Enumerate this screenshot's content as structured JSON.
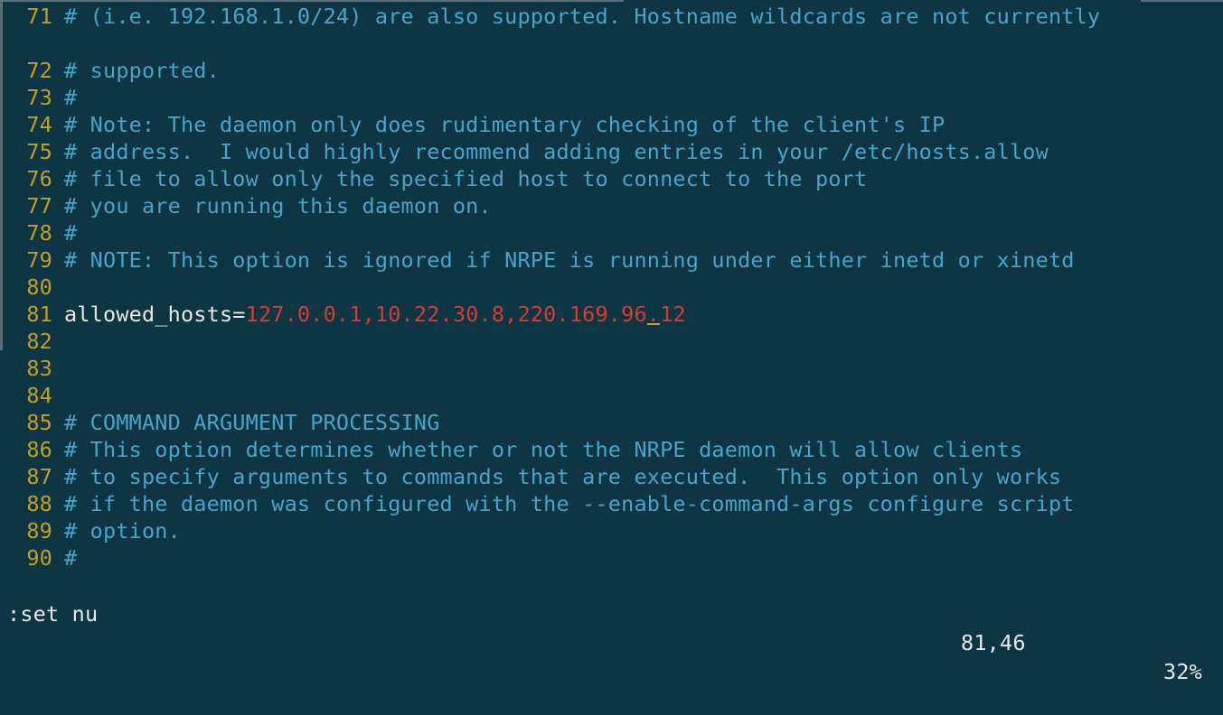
{
  "editor": {
    "lines": [
      {
        "num": "71",
        "text": "# (i.e. 192.168.1.0/24) are also supported. Hostname wildcards are not currently"
      },
      {
        "num": "",
        "text": ""
      },
      {
        "num": "72",
        "text": "# supported."
      },
      {
        "num": "73",
        "text": "#"
      },
      {
        "num": "74",
        "text": "# Note: The daemon only does rudimentary checking of the client's IP"
      },
      {
        "num": "75",
        "text": "# address.  I would highly recommend adding entries in your /etc/hosts.allow"
      },
      {
        "num": "76",
        "text": "# file to allow only the specified host to connect to the port"
      },
      {
        "num": "77",
        "text": "# you are running this daemon on."
      },
      {
        "num": "78",
        "text": "#"
      },
      {
        "num": "79",
        "text": "# NOTE: This option is ignored if NRPE is running under either inetd or xinetd"
      },
      {
        "num": "80",
        "text": ""
      },
      {
        "num": "81",
        "key": "allowed_hosts=",
        "value_before_cursor": "127.0.0.1,10.22.30.8,220.169.96",
        "cursor_char": ".",
        "value_after_cursor": "12"
      },
      {
        "num": "82",
        "text": ""
      },
      {
        "num": "83",
        "text": ""
      },
      {
        "num": "84",
        "text": ""
      },
      {
        "num": "85",
        "text": "# COMMAND ARGUMENT PROCESSING"
      },
      {
        "num": "86",
        "text": "# This option determines whether or not the NRPE daemon will allow clients"
      },
      {
        "num": "87",
        "text": "# to specify arguments to commands that are executed.  This option only works"
      },
      {
        "num": "88",
        "text": "# if the daemon was configured with the --enable-command-args configure script"
      },
      {
        "num": "89",
        "text": "# option."
      },
      {
        "num": "90",
        "text": "#"
      }
    ]
  },
  "status": {
    "command": ":set nu",
    "cursor_position": "81,46",
    "scroll_percent": "32%"
  },
  "colors": {
    "background": "#0d3543",
    "line_number": "#c5a01c",
    "comment": "#4aa3c8",
    "key": "#e8e8e8",
    "value": "#d83c31"
  }
}
